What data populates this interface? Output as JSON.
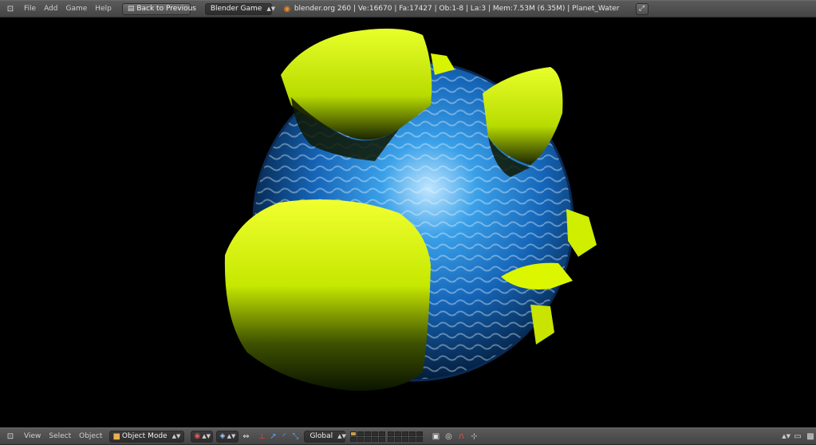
{
  "top_bar": {
    "menus": [
      "File",
      "Add",
      "Game",
      "Help"
    ],
    "back_button": "Back to Previous",
    "engine": "Blender Game",
    "info": "blender.org 260 | Ve:16670 | Fa:17427 | Ob:1-8 | La:3 | Mem:7.53M (6.35M) | Planet_Water",
    "icons": [
      "editor-type-icon",
      "blender-logo-icon",
      "fullscreen-icon"
    ]
  },
  "bottom_bar": {
    "menus": [
      "View",
      "Select",
      "Object"
    ],
    "mode": "Object Mode",
    "orientation": "Global",
    "icons": [
      "editor-type-icon",
      "shading-icon",
      "pivot-icon",
      "manipulator-icon",
      "layers-icon",
      "snap-icon",
      "render-icon"
    ]
  },
  "colors": {
    "toolbar": "#4a4a4a",
    "viewport": "#000000",
    "land": "#d4f000",
    "water": "#1e7fd0"
  }
}
